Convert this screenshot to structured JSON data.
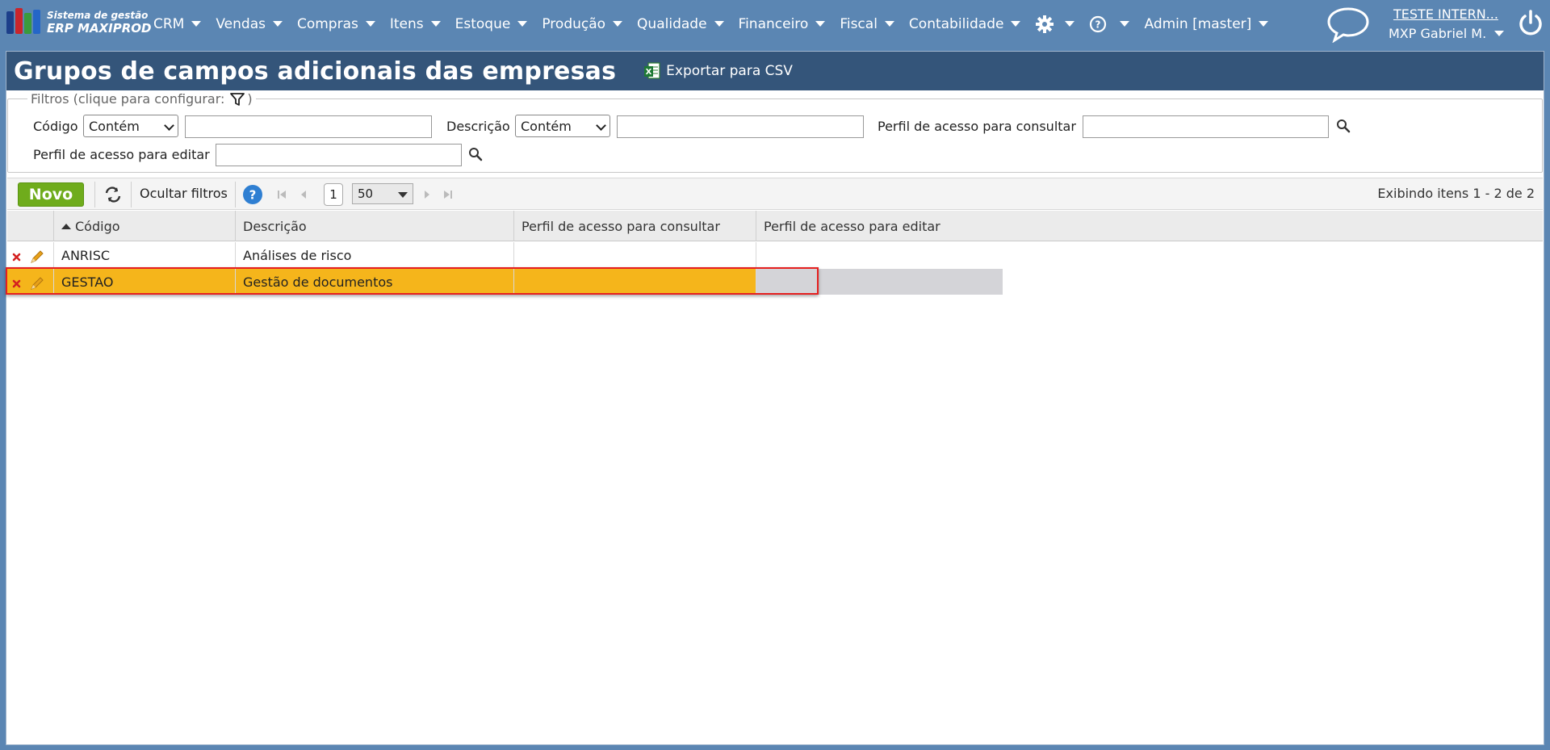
{
  "app": {
    "brand_line1": "Sistema de gestão",
    "brand_line2": "ERP MAXIPROD"
  },
  "nav": {
    "menus": [
      "CRM",
      "Vendas",
      "Compras",
      "Itens",
      "Estoque",
      "Produção",
      "Qualidade",
      "Financeiro",
      "Fiscal",
      "Contabilidade"
    ],
    "admin_label": "Admin [master]",
    "company_link": "TESTE INTERN...",
    "user_name": "MXP Gabriel M."
  },
  "page": {
    "title": "Grupos de campos adicionais das empresas",
    "export_label": "Exportar para CSV"
  },
  "filters": {
    "legend": "Filtros (clique para configurar:",
    "legend_close": ")",
    "codigo_label": "Código",
    "codigo_operator": "Contém",
    "codigo_value": "",
    "descricao_label": "Descrição",
    "descricao_operator": "Contém",
    "descricao_value": "",
    "perfil_consultar_label": "Perfil de acesso para consultar",
    "perfil_consultar_value": "",
    "perfil_editar_label": "Perfil de acesso para editar",
    "perfil_editar_value": ""
  },
  "toolbar": {
    "new_label": "Novo",
    "hide_filters_label": "Ocultar filtros",
    "page_number": "1",
    "page_size": "50",
    "count_text": "Exibindo itens 1 - 2 de 2"
  },
  "grid": {
    "columns": [
      "Código",
      "Descrição",
      "Perfil de acesso para consultar",
      "Perfil de acesso para editar"
    ],
    "sort_column": "Código",
    "sort_direction": "asc",
    "rows": [
      {
        "codigo": "ANRISC",
        "descricao": "Análises de risco",
        "perfil_consultar": "",
        "perfil_editar": "",
        "selected": false
      },
      {
        "codigo": "GESTAO",
        "descricao": "Gestão de documentos",
        "perfil_consultar": "",
        "perfil_editar": "",
        "selected": true
      }
    ]
  },
  "colors": {
    "topbar": "#5b86b3",
    "title_bar": "#34557a",
    "new_button": "#6fac1c",
    "selected_row": "#f5b51b",
    "highlight_frame": "#e51f1f"
  }
}
